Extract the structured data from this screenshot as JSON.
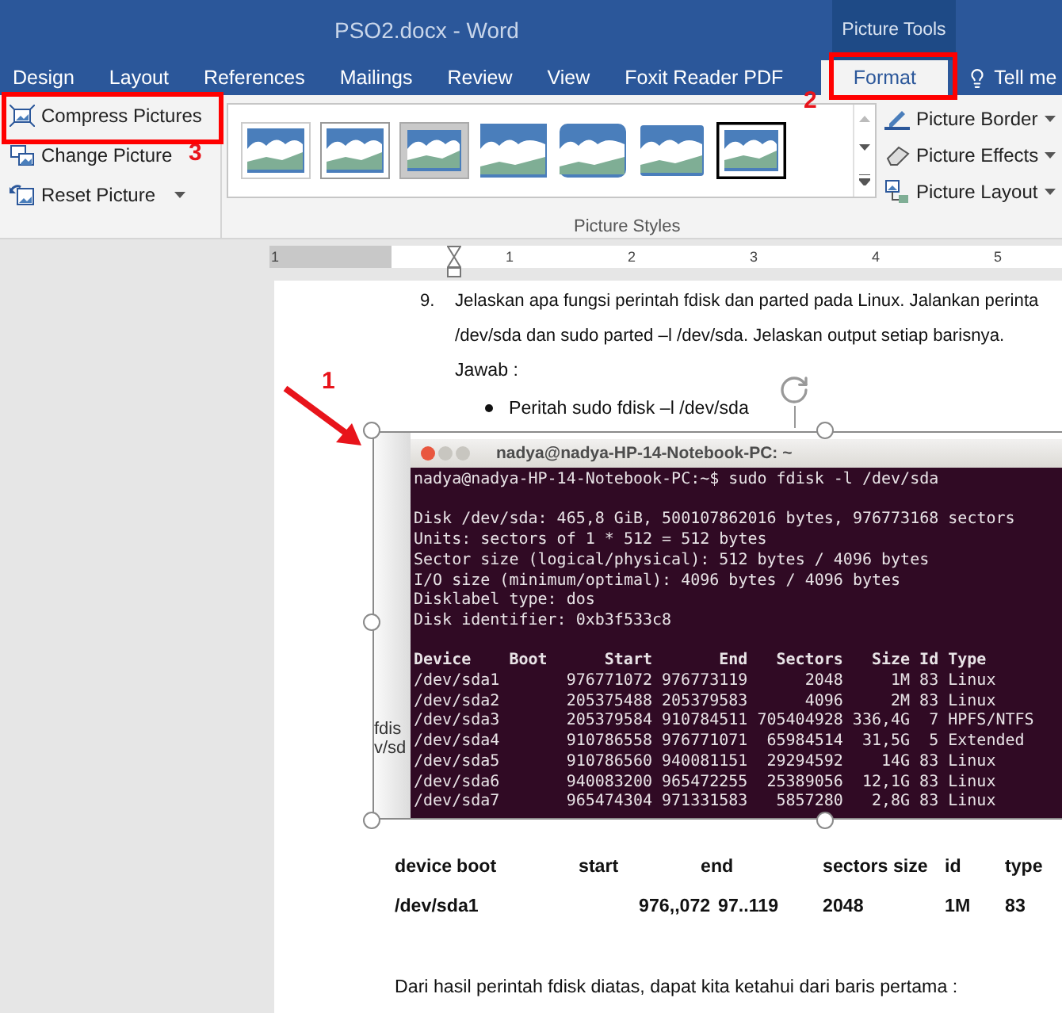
{
  "window": {
    "title": "PSO2.docx - Word",
    "context_tab_group": "Picture Tools"
  },
  "tabs": [
    {
      "label": "Design",
      "selected": false
    },
    {
      "label": "Layout",
      "selected": false
    },
    {
      "label": "References",
      "selected": false
    },
    {
      "label": "Mailings",
      "selected": false
    },
    {
      "label": "Review",
      "selected": false
    },
    {
      "label": "View",
      "selected": false
    },
    {
      "label": "Foxit Reader PDF",
      "selected": false
    },
    {
      "label": "Format",
      "selected": true
    }
  ],
  "tell_me": {
    "label": "Tell me"
  },
  "ribbon": {
    "adjust_buttons": [
      {
        "label": "Compress Pictures"
      },
      {
        "label": "Change Picture"
      },
      {
        "label": "Reset Picture",
        "dropdown": true
      }
    ],
    "group_label": "Picture Styles",
    "style_buttons": [
      {
        "label": "Picture Border",
        "dropdown": true
      },
      {
        "label": "Picture Effects",
        "dropdown": true
      },
      {
        "label": "Picture Layout",
        "dropdown": true
      }
    ]
  },
  "ruler": {
    "labels": [
      "1",
      "1",
      "2",
      "3",
      "4",
      "5"
    ]
  },
  "document": {
    "question": {
      "number": "9.",
      "lines": [
        "Jelaskan apa fungsi perintah fdisk dan parted pada Linux. Jalankan perinta",
        "/dev/sda dan sudo parted –l /dev/sda. Jelaskan output setiap barisnya."
      ]
    },
    "answer_label": "Jawab  :",
    "bullet": "Peritah sudo fdisk –l /dev/sda",
    "picture": {
      "background_fragments": [
        "fdis",
        "v/sd"
      ],
      "terminal": {
        "title": "nadya@nadya-HP-14-Notebook-PC: ~",
        "prompt": "nadya@nadya-HP-14-Notebook-PC:~$ sudo fdisk -l /dev/sda",
        "info_lines": [
          "Disk /dev/sda: 465,8 GiB, 500107862016 bytes, 976773168 sectors",
          "Units: sectors of 1 * 512 = 512 bytes",
          "Sector size (logical/physical): 512 bytes / 4096 bytes",
          "I/O size (minimum/optimal): 4096 bytes / 4096 bytes",
          "Disklabel type: dos",
          "Disk identifier: 0xb3f533c8"
        ],
        "columns": [
          "Device",
          "Boot",
          "Start",
          "End",
          "Sectors",
          "Size",
          "Id",
          "Type"
        ],
        "rows": [
          [
            "/dev/sda1",
            "",
            "976771072",
            "976773119",
            "2048",
            "1M",
            "83",
            "Linux"
          ],
          [
            "/dev/sda2",
            "",
            "205375488",
            "205379583",
            "4096",
            "2M",
            "83",
            "Linux"
          ],
          [
            "/dev/sda3",
            "",
            "205379584",
            "910784511",
            "705404928",
            "336,4G",
            "7",
            "HPFS/NTFS"
          ],
          [
            "/dev/sda4",
            "",
            "910786558",
            "976771071",
            "65984514",
            "31,5G",
            "5",
            "Extended"
          ],
          [
            "/dev/sda5",
            "",
            "910786560",
            "940081151",
            "29294592",
            "14G",
            "83",
            "Linux"
          ],
          [
            "/dev/sda6",
            "",
            "940083200",
            "965472255",
            "25389056",
            "12,1G",
            "83",
            "Linux"
          ],
          [
            "/dev/sda7",
            "",
            "965474304",
            "971331583",
            "5857280",
            "2,8G",
            "83",
            "Linux"
          ]
        ]
      }
    },
    "summary_table": {
      "header": [
        "device",
        "boot",
        "start",
        "end",
        "sectors size",
        "id",
        "type"
      ],
      "row": [
        "/dev/sda1",
        "976,,072",
        "97..119",
        "2048",
        "1M",
        "83"
      ]
    },
    "closing_text": "Dari hasil perintah fdisk diatas, dapat kita ketahui dari baris pertama :"
  },
  "annotations": [
    {
      "label": "1",
      "kind": "arrow"
    },
    {
      "label": "2",
      "kind": "frame"
    },
    {
      "label": "3",
      "kind": "frame"
    }
  ]
}
